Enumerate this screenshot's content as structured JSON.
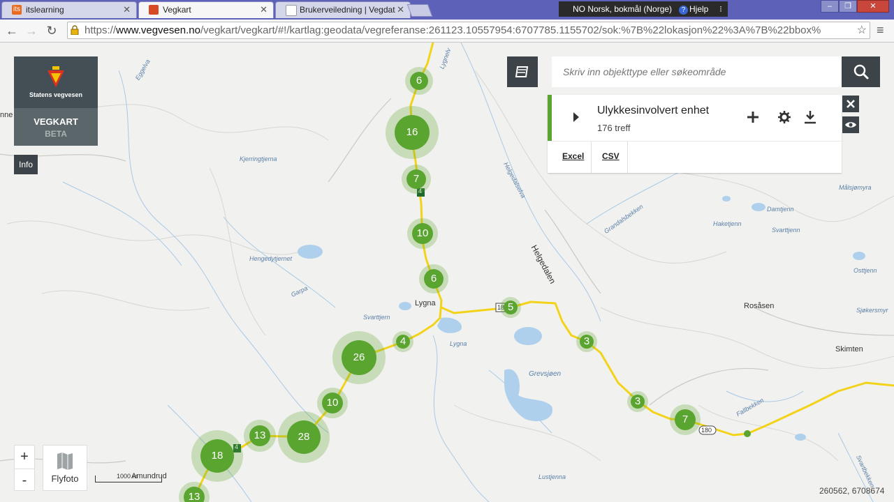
{
  "browser": {
    "tabs": [
      {
        "label": "itslearning",
        "icon_text": "its",
        "icon_color": "#e96c1e"
      },
      {
        "label": "Vegkart",
        "icon_color": "#d64b26"
      },
      {
        "label": "Brukerveiledning | Vegdat",
        "icon_color": "#bbbbbb"
      }
    ],
    "language": "NO Norsk, bokmål (Norge)",
    "help": "Hjelp",
    "url_prefix": "https://",
    "url_host": "www.vegvesen.no",
    "url_path": "/vegkart/vegkart/#!/kartlag:geodata/vegreferanse:261123.10557954:6707785.1155702/sok:%7B%22lokasjon%22%3A%7B%22bbox%"
  },
  "app": {
    "org_name": "Statens vegvesen",
    "app_name": "VEGKART",
    "beta": "BETA",
    "info_label": "Info",
    "search_placeholder": "Skriv inn objekttype eller søkeområde"
  },
  "result_panel": {
    "title": "Ulykkesinvolvert enhet",
    "count": "176 treff",
    "export_excel": "Excel",
    "export_csv": "CSV"
  },
  "map": {
    "flyfoto_label": "Flyfoto",
    "zoom_in": "+",
    "zoom_out": "-",
    "scale_label": "1000 m",
    "coords": "260562, 6708674",
    "places": {
      "lygna": "Lygna",
      "helgedalen": "Helgedalen",
      "rosasen": "Rosåsen",
      "skimten": "Skimten",
      "amundrud": "Amundrud",
      "nne": "nne"
    },
    "water_labels": {
      "kjerringtjerna": "Kjerringtjerna",
      "hengedytjernet": "Hengedytjernet",
      "garpa": "Garpa",
      "svarttjern_w": "Svarttjern",
      "lygna_river": "Lygna",
      "grevsjoen": "Grevsjøen",
      "helgedalselva": "Helgedalselva",
      "grandalsbekken": "Grandalsbekken",
      "damtjenn": "Damtjenn",
      "haketjenn": "Haketjenn",
      "svarttjenn_e": "Svarttjenn",
      "malsjomyra": "Målsjømyra",
      "osttjenn": "Osttjenn",
      "sjokersmyra": "Sjøkersmyr",
      "fallbekken": "Fallbekken",
      "lustjenna": "Lustjenna",
      "eggelva": "Eggelva",
      "lygnelva": "Lygnelv",
      "svartbekken": "Svartbekken"
    },
    "road_labels": {
      "r4_a": "4",
      "r4_b": "4",
      "r180_a": "18",
      "r180_b": "180"
    },
    "clusters": {
      "c1": 6,
      "c2": 16,
      "c3": 7,
      "c4": 10,
      "c5": 6,
      "c6": 5,
      "c7": 4,
      "c8": 26,
      "c9": 3,
      "c10": 10,
      "c11": 3,
      "c12": 7,
      "c13": 13,
      "c14": 28,
      "c15": 18,
      "c16": 13
    },
    "colors": {
      "cluster": "#5aa530",
      "road": "#f3d31a",
      "water": "#aed0ec",
      "panel_accent": "#5aa530",
      "dark_button": "#3c4449"
    }
  }
}
